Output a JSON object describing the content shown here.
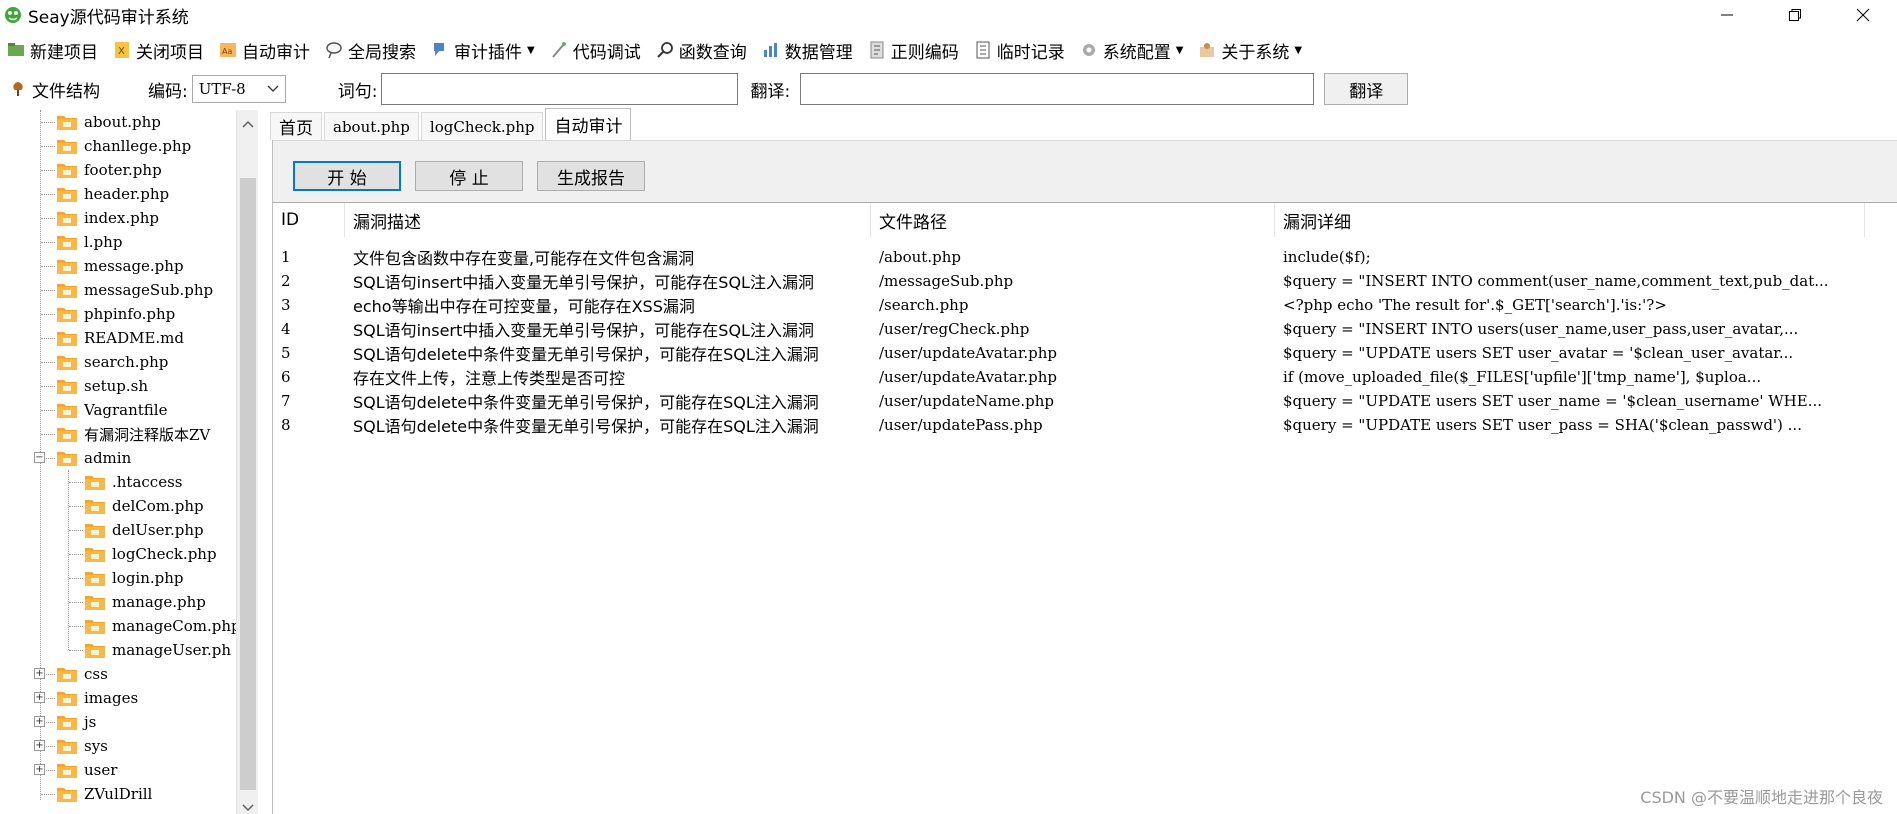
{
  "window": {
    "title": "Seay源代码审计系统"
  },
  "toolbar": {
    "items": [
      {
        "label": "新建项目",
        "icon": "new-project-icon"
      },
      {
        "label": "关闭项目",
        "icon": "close-project-icon"
      },
      {
        "label": "自动审计",
        "icon": "auto-audit-icon"
      },
      {
        "label": "全局搜索",
        "icon": "global-search-icon"
      },
      {
        "label": "审计插件",
        "icon": "plugin-icon",
        "dropdown": true
      },
      {
        "label": "代码调试",
        "icon": "debug-icon"
      },
      {
        "label": "函数查询",
        "icon": "function-search-icon"
      },
      {
        "label": "数据管理",
        "icon": "data-manage-icon"
      },
      {
        "label": "正则编码",
        "icon": "regex-icon"
      },
      {
        "label": "临时记录",
        "icon": "note-icon"
      },
      {
        "label": "系统配置",
        "icon": "gear-icon",
        "dropdown": true
      },
      {
        "label": "关于系统",
        "icon": "about-icon",
        "dropdown": true
      }
    ]
  },
  "bar2": {
    "structure_label": "文件结构",
    "encoding_label": "编码:",
    "encoding_value": "UTF-8",
    "word_label": "词句:",
    "word_value": "",
    "translate_label": "翻译:",
    "translate_value": "",
    "translate_button": "翻译"
  },
  "tree": {
    "items": [
      {
        "label": "about.php",
        "level": 1
      },
      {
        "label": "chanllege.php",
        "level": 1
      },
      {
        "label": "footer.php",
        "level": 1
      },
      {
        "label": "header.php",
        "level": 1
      },
      {
        "label": "index.php",
        "level": 1
      },
      {
        "label": "l.php",
        "level": 1
      },
      {
        "label": "message.php",
        "level": 1
      },
      {
        "label": "messageSub.php",
        "level": 1
      },
      {
        "label": "phpinfo.php",
        "level": 1
      },
      {
        "label": "README.md",
        "level": 1
      },
      {
        "label": "search.php",
        "level": 1
      },
      {
        "label": "setup.sh",
        "level": 1
      },
      {
        "label": "Vagrantfile",
        "level": 1
      },
      {
        "label": "有漏洞注释版本ZV",
        "level": 1
      },
      {
        "label": "admin",
        "level": 1,
        "expander": "−"
      },
      {
        "label": ".htaccess",
        "level": 2
      },
      {
        "label": "delCom.php",
        "level": 2
      },
      {
        "label": "delUser.php",
        "level": 2
      },
      {
        "label": "logCheck.php",
        "level": 2
      },
      {
        "label": "login.php",
        "level": 2
      },
      {
        "label": "manage.php",
        "level": 2
      },
      {
        "label": "manageCom.php",
        "level": 2
      },
      {
        "label": "manageUser.ph",
        "level": 2
      },
      {
        "label": "css",
        "level": 1,
        "expander": "+"
      },
      {
        "label": "images",
        "level": 1,
        "expander": "+"
      },
      {
        "label": "js",
        "level": 1,
        "expander": "+"
      },
      {
        "label": "sys",
        "level": 1,
        "expander": "+"
      },
      {
        "label": "user",
        "level": 1,
        "expander": "+"
      },
      {
        "label": "ZVulDrill",
        "level": 1
      }
    ]
  },
  "tabs": [
    {
      "label": "首页",
      "serif": false
    },
    {
      "label": "about.php",
      "serif": true
    },
    {
      "label": "logCheck.php",
      "serif": true
    },
    {
      "label": "自动审计",
      "serif": false,
      "active": true
    }
  ],
  "actions": {
    "start": "开 始",
    "stop": "停 止",
    "report": "生成报告"
  },
  "results": {
    "columns": [
      "ID",
      "漏洞描述",
      "文件路径",
      "漏洞详细"
    ],
    "rows": [
      [
        "1",
        "文件包含函数中存在变量,可能存在文件包含漏洞",
        "/about.php",
        "include($f);"
      ],
      [
        "2",
        "SQL语句insert中插入变量无单引号保护，可能存在SQL注入漏洞",
        "/messageSub.php",
        "$query = \"INSERT INTO comment(user_name,comment_text,pub_dat..."
      ],
      [
        "3",
        "echo等输出中存在可控变量，可能存在XSS漏洞",
        "/search.php",
        "<?php echo 'The result for'.$_GET['search'].'is:'?>"
      ],
      [
        "4",
        "SQL语句insert中插入变量无单引号保护，可能存在SQL注入漏洞",
        "/user/regCheck.php",
        "$query = \"INSERT INTO users(user_name,user_pass,user_avatar,..."
      ],
      [
        "5",
        "SQL语句delete中条件变量无单引号保护，可能存在SQL注入漏洞",
        "/user/updateAvatar.php",
        "$query = \"UPDATE users SET user_avatar = '$clean_user_avatar..."
      ],
      [
        "6",
        "存在文件上传，注意上传类型是否可控",
        "/user/updateAvatar.php",
        "if (move_uploaded_file($_FILES['upfile']['tmp_name'], $uploa..."
      ],
      [
        "7",
        "SQL语句delete中条件变量无单引号保护，可能存在SQL注入漏洞",
        "/user/updateName.php",
        "$query = \"UPDATE users SET user_name = '$clean_username' WHE..."
      ],
      [
        "8",
        "SQL语句delete中条件变量无单引号保护，可能存在SQL注入漏洞",
        "/user/updatePass.php",
        "$query = \"UPDATE users SET user_pass = SHA('$clean_passwd') ..."
      ]
    ]
  },
  "watermark": "CSDN @不要温顺地走进那个良夜",
  "colors": {
    "folder": "#f6a623",
    "focus": "#0078d7",
    "panel": "#f0f0f0"
  }
}
